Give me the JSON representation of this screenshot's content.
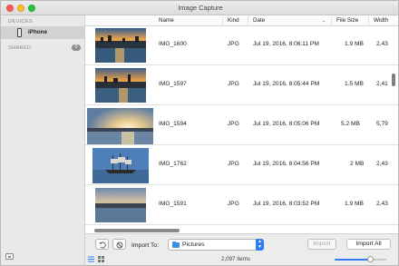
{
  "window": {
    "title": "Image Capture"
  },
  "sidebar": {
    "devices_heading": "DEVICES",
    "device_name": "iPhone",
    "shared_heading": "SHARED",
    "shared_count": "0"
  },
  "columns": {
    "name": "Name",
    "kind": "Kind",
    "date": "Date",
    "file_size": "File Size",
    "width": "Width"
  },
  "rows": [
    {
      "name": "IMG_1600",
      "kind": "JPG",
      "date": "Jul 19, 2016, 8:06:11 PM",
      "size": "1.9 MB",
      "width": "2,43"
    },
    {
      "name": "IMG_1597",
      "kind": "JPG",
      "date": "Jul 19, 2016, 8:05:44 PM",
      "size": "1.5 MB",
      "width": "2,41"
    },
    {
      "name": "IMG_1594",
      "kind": "JPG",
      "date": "Jul 19, 2016, 8:05:06 PM",
      "size": "5.2 MB",
      "width": "5,79"
    },
    {
      "name": "IMG_1762",
      "kind": "JPG",
      "date": "Jul 19, 2016, 8:04:56 PM",
      "size": "2 MB",
      "width": "2,43"
    },
    {
      "name": "IMG_1591",
      "kind": "JPG",
      "date": "Jul 19, 2016, 8:03:52 PM",
      "size": "1.9 MB",
      "width": "2,43"
    }
  ],
  "toolbar": {
    "import_to_label": "Import To:",
    "destination": "Pictures",
    "import_label": "Import",
    "import_all_label": "Import All"
  },
  "status": {
    "items_count": "2,097 items",
    "thumbnail_size_fraction": 0.7
  },
  "colors": {
    "accent": "#2f7cf6",
    "folder": "#3a8ee6"
  },
  "icons": {
    "device": "iphone-icon",
    "rotate": "rotate-left-icon",
    "delete": "delete-icon",
    "folder": "folder-icon",
    "list_view": "list-view-icon",
    "grid_view": "grid-view-icon"
  }
}
